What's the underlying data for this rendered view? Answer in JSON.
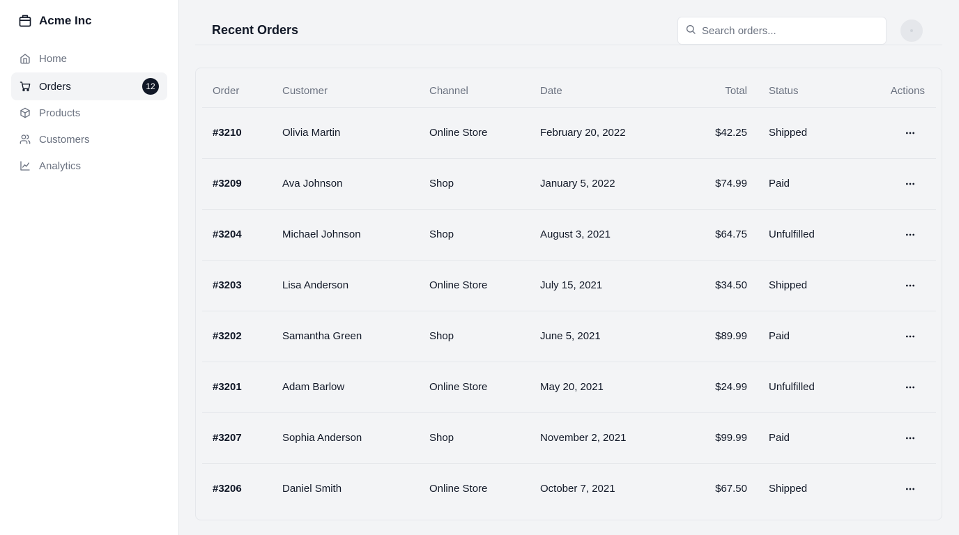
{
  "app": {
    "name": "Acme Inc"
  },
  "sidebar": {
    "items": [
      {
        "label": "Home",
        "icon": "home-icon"
      },
      {
        "label": "Orders",
        "icon": "cart-icon",
        "badge": "12",
        "active": true
      },
      {
        "label": "Products",
        "icon": "package-icon"
      },
      {
        "label": "Customers",
        "icon": "users-icon"
      },
      {
        "label": "Analytics",
        "icon": "line-chart-icon"
      }
    ]
  },
  "header": {
    "title": "Recent Orders",
    "search_placeholder": "Search orders...",
    "search_value": ""
  },
  "table": {
    "columns": [
      "Order",
      "Customer",
      "Channel",
      "Date",
      "Total",
      "Status",
      "Actions"
    ],
    "rows": [
      {
        "order": "#3210",
        "customer": "Olivia Martin",
        "channel": "Online Store",
        "date": "February 20, 2022",
        "total": "$42.25",
        "status": "Shipped"
      },
      {
        "order": "#3209",
        "customer": "Ava Johnson",
        "channel": "Shop",
        "date": "January 5, 2022",
        "total": "$74.99",
        "status": "Paid"
      },
      {
        "order": "#3204",
        "customer": "Michael Johnson",
        "channel": "Shop",
        "date": "August 3, 2021",
        "total": "$64.75",
        "status": "Unfulfilled"
      },
      {
        "order": "#3203",
        "customer": "Lisa Anderson",
        "channel": "Online Store",
        "date": "July 15, 2021",
        "total": "$34.50",
        "status": "Shipped"
      },
      {
        "order": "#3202",
        "customer": "Samantha Green",
        "channel": "Shop",
        "date": "June 5, 2021",
        "total": "$89.99",
        "status": "Paid"
      },
      {
        "order": "#3201",
        "customer": "Adam Barlow",
        "channel": "Online Store",
        "date": "May 20, 2021",
        "total": "$24.99",
        "status": "Unfulfilled"
      },
      {
        "order": "#3207",
        "customer": "Sophia Anderson",
        "channel": "Shop",
        "date": "November 2, 2021",
        "total": "$99.99",
        "status": "Paid"
      },
      {
        "order": "#3206",
        "customer": "Daniel Smith",
        "channel": "Online Store",
        "date": "October 7, 2021",
        "total": "$67.50",
        "status": "Shipped"
      }
    ]
  },
  "colors": {
    "sidebar_bg": "#ffffff",
    "main_bg": "#f3f4f6",
    "text_primary": "#111827",
    "text_muted": "#6b7280",
    "border": "#e5e7eb",
    "badge_bg": "#111827"
  }
}
